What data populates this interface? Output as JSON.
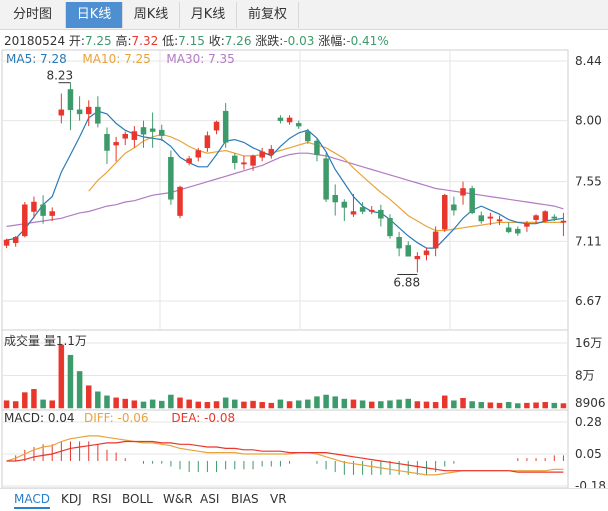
{
  "tabs": [
    {
      "label": "分时图",
      "active": false
    },
    {
      "label": "日K线",
      "active": true
    },
    {
      "label": "周K线",
      "active": false
    },
    {
      "label": "月K线",
      "active": false
    },
    {
      "label": "前复权",
      "active": false
    }
  ],
  "info": {
    "date": "20180524",
    "open_label": "开:",
    "open": "7.25",
    "high_label": "高:",
    "high": "7.32",
    "low_label": "低:",
    "low": "7.15",
    "close_label": "收:",
    "close": "7.26",
    "change_label": "涨跌:",
    "change": "-0.03",
    "pct_label": "涨幅:",
    "pct": "-0.41%"
  },
  "ma_legend": [
    {
      "label": "MA5: 7.28",
      "color": "#2a7ab8"
    },
    {
      "label": "MA10: 7.25",
      "color": "#e8a33c"
    },
    {
      "label": "MA30: 7.35",
      "color": "#b27bc4"
    }
  ],
  "colors": {
    "up": "#e8362c",
    "down": "#3d9a6a",
    "grid": "#e6e6e6",
    "axis": "#cfcfcf"
  },
  "bottom_tabs": [
    "MACD",
    "KDJ",
    "RSI",
    "BOLL",
    "W&R",
    "ASI",
    "BIAS",
    "VR"
  ],
  "chart_data": [
    {
      "type": "candlestick",
      "y_ticks": [
        "8.44",
        "8.00",
        "7.55",
        "7.11",
        "6.67"
      ],
      "ylim": [
        6.67,
        8.44
      ],
      "annotations": [
        {
          "text": "8.23"
        },
        {
          "text": "6.88"
        }
      ],
      "ohlc": [
        [
          7.08,
          7.13,
          7.06,
          7.12
        ],
        [
          7.1,
          7.15,
          7.07,
          7.14
        ],
        [
          7.15,
          7.4,
          7.14,
          7.38
        ],
        [
          7.33,
          7.44,
          7.28,
          7.4
        ],
        [
          7.38,
          7.45,
          7.24,
          7.3
        ],
        [
          7.3,
          7.36,
          7.26,
          7.33
        ],
        [
          8.04,
          8.2,
          7.98,
          8.08
        ],
        [
          8.23,
          8.28,
          7.93,
          8.08
        ],
        [
          8.08,
          8.18,
          8.0,
          8.05
        ],
        [
          8.05,
          8.15,
          7.96,
          8.1
        ],
        [
          8.1,
          8.18,
          7.95,
          7.98
        ],
        [
          7.9,
          7.95,
          7.68,
          7.78
        ],
        [
          7.82,
          7.88,
          7.7,
          7.84
        ],
        [
          7.87,
          7.92,
          7.82,
          7.9
        ],
        [
          7.86,
          7.96,
          7.8,
          7.92
        ],
        [
          7.95,
          8.0,
          7.8,
          7.9
        ],
        [
          7.94,
          8.06,
          7.8,
          7.92
        ],
        [
          7.93,
          7.97,
          7.85,
          7.89
        ],
        [
          7.73,
          7.78,
          7.38,
          7.42
        ],
        [
          7.3,
          7.52,
          7.28,
          7.51
        ],
        [
          7.69,
          7.74,
          7.67,
          7.72
        ],
        [
          7.73,
          7.8,
          7.7,
          7.78
        ],
        [
          7.8,
          7.92,
          7.77,
          7.89
        ],
        [
          7.93,
          8.0,
          7.9,
          7.99
        ],
        [
          8.07,
          8.13,
          7.8,
          7.84
        ],
        [
          7.74,
          7.76,
          7.64,
          7.69
        ],
        [
          7.68,
          7.74,
          7.64,
          7.69
        ],
        [
          7.67,
          7.75,
          7.63,
          7.74
        ],
        [
          7.73,
          7.8,
          7.7,
          7.77
        ],
        [
          7.75,
          7.82,
          7.72,
          7.79
        ],
        [
          8.02,
          8.04,
          7.98,
          8.0
        ],
        [
          7.99,
          8.04,
          7.97,
          8.02
        ],
        [
          7.98,
          8.0,
          7.94,
          7.96
        ],
        [
          7.92,
          7.94,
          7.83,
          7.85
        ],
        [
          7.85,
          7.87,
          7.7,
          7.75
        ],
        [
          7.72,
          7.76,
          7.4,
          7.42
        ],
        [
          7.45,
          7.53,
          7.3,
          7.4
        ],
        [
          7.4,
          7.42,
          7.26,
          7.36
        ],
        [
          7.31,
          7.46,
          7.29,
          7.33
        ],
        [
          7.36,
          7.4,
          7.31,
          7.33
        ],
        [
          7.33,
          7.37,
          7.31,
          7.34
        ],
        [
          7.34,
          7.38,
          7.22,
          7.28
        ],
        [
          7.28,
          7.31,
          7.13,
          7.15
        ],
        [
          7.14,
          7.18,
          7.0,
          7.06
        ],
        [
          7.08,
          7.11,
          7.0,
          7.0
        ],
        [
          6.98,
          7.03,
          6.88,
          7.0
        ],
        [
          7.01,
          7.06,
          6.97,
          7.04
        ],
        [
          7.06,
          7.22,
          7.0,
          7.18
        ],
        [
          7.2,
          7.46,
          7.18,
          7.45
        ],
        [
          7.38,
          7.44,
          7.3,
          7.34
        ],
        [
          7.45,
          7.55,
          7.38,
          7.5
        ],
        [
          7.5,
          7.52,
          7.31,
          7.32
        ],
        [
          7.3,
          7.33,
          7.24,
          7.26
        ],
        [
          7.28,
          7.32,
          7.23,
          7.29
        ],
        [
          7.26,
          7.3,
          7.23,
          7.27
        ],
        [
          7.21,
          7.25,
          7.17,
          7.18
        ],
        [
          7.2,
          7.22,
          7.15,
          7.17
        ],
        [
          7.22,
          7.26,
          7.18,
          7.24
        ],
        [
          7.27,
          7.31,
          7.24,
          7.3
        ],
        [
          7.26,
          7.34,
          7.25,
          7.33
        ],
        [
          7.29,
          7.31,
          7.26,
          7.28
        ],
        [
          7.25,
          7.32,
          7.15,
          7.26
        ]
      ],
      "ma5": [
        7.12,
        7.13,
        7.2,
        7.29,
        7.38,
        7.44,
        7.62,
        7.75,
        7.88,
        8.02,
        8.07,
        8.05,
        7.98,
        7.93,
        7.9,
        7.88,
        7.87,
        7.86,
        7.81,
        7.73,
        7.69,
        7.66,
        7.66,
        7.75,
        7.85,
        7.86,
        7.84,
        7.8,
        7.77,
        7.74,
        7.81,
        7.87,
        7.91,
        7.93,
        7.87,
        7.77,
        7.64,
        7.54,
        7.44,
        7.37,
        7.33,
        7.32,
        7.27,
        7.21,
        7.15,
        7.1,
        7.06,
        7.06,
        7.13,
        7.2,
        7.28,
        7.34,
        7.37,
        7.34,
        7.31,
        7.27,
        7.25,
        7.24,
        7.24,
        7.26,
        7.27,
        7.28
      ],
      "ma10": [
        null,
        null,
        null,
        null,
        null,
        null,
        null,
        null,
        null,
        7.48,
        7.56,
        7.62,
        7.69,
        7.76,
        7.8,
        7.85,
        7.88,
        7.9,
        7.88,
        7.85,
        7.81,
        7.78,
        7.76,
        7.77,
        7.78,
        7.76,
        7.74,
        7.74,
        7.75,
        7.76,
        7.78,
        7.8,
        7.82,
        7.84,
        7.82,
        7.8,
        7.76,
        7.72,
        7.65,
        7.59,
        7.53,
        7.47,
        7.42,
        7.36,
        7.3,
        7.26,
        7.22,
        7.19,
        7.19,
        7.2,
        7.21,
        7.22,
        7.23,
        7.24,
        7.25,
        7.25,
        7.25,
        7.25,
        7.25,
        7.25,
        7.25,
        7.25
      ],
      "ma30": [
        7.22,
        7.23,
        7.24,
        7.25,
        7.26,
        7.27,
        7.28,
        7.3,
        7.32,
        7.33,
        7.35,
        7.37,
        7.38,
        7.4,
        7.41,
        7.43,
        7.45,
        7.46,
        7.47,
        7.49,
        7.51,
        7.53,
        7.55,
        7.57,
        7.59,
        7.61,
        7.63,
        7.65,
        7.67,
        7.7,
        7.73,
        7.75,
        7.76,
        7.76,
        7.75,
        7.74,
        7.72,
        7.7,
        7.68,
        7.66,
        7.64,
        7.62,
        7.6,
        7.58,
        7.56,
        7.54,
        7.52,
        7.5,
        7.49,
        7.48,
        7.47,
        7.46,
        7.45,
        7.44,
        7.43,
        7.42,
        7.41,
        7.4,
        7.39,
        7.38,
        7.37,
        7.35
      ]
    },
    {
      "type": "bar",
      "title": "成交量 量1.1万",
      "y_ticks": [
        "16万",
        "8万",
        "8906"
      ],
      "ylim": [
        0,
        160000
      ],
      "values": [
        18000,
        16000,
        38000,
        46000,
        20000,
        18000,
        155000,
        130000,
        90000,
        55000,
        40000,
        30000,
        25000,
        22000,
        18000,
        15000,
        20000,
        17000,
        32000,
        25000,
        20000,
        15000,
        14000,
        16000,
        25000,
        20000,
        15000,
        17000,
        14000,
        12000,
        20000,
        16000,
        18000,
        20000,
        28000,
        32000,
        28000,
        22000,
        20000,
        18000,
        15000,
        16000,
        18000,
        20000,
        22000,
        16000,
        15000,
        14000,
        30000,
        18000,
        24000,
        16000,
        14000,
        13000,
        12000,
        14000,
        11000,
        12000,
        13000,
        14000,
        12000,
        11000
      ],
      "up": [
        true,
        true,
        true,
        true,
        false,
        true,
        true,
        false,
        false,
        true,
        false,
        false,
        true,
        true,
        true,
        false,
        false,
        false,
        false,
        true,
        true,
        true,
        true,
        true,
        false,
        false,
        true,
        true,
        true,
        true,
        false,
        true,
        false,
        false,
        false,
        false,
        false,
        false,
        true,
        false,
        true,
        false,
        false,
        false,
        false,
        true,
        true,
        true,
        true,
        false,
        true,
        false,
        false,
        true,
        true,
        false,
        false,
        true,
        true,
        true,
        false,
        true
      ]
    },
    {
      "type": "line",
      "title_parts": [
        {
          "label": "MACD: 0.04",
          "color": "#333333"
        },
        {
          "label": "DIFF: -0.06",
          "color": "#e8a33c"
        },
        {
          "label": "DEA: -0.08",
          "color": "#e8362c"
        }
      ],
      "y_ticks": [
        "0.28",
        "0.05",
        "-0.18"
      ],
      "ylim": [
        -0.18,
        0.28
      ],
      "diff": [
        0.0,
        0.02,
        0.05,
        0.08,
        0.1,
        0.11,
        0.14,
        0.16,
        0.17,
        0.18,
        0.18,
        0.17,
        0.16,
        0.15,
        0.14,
        0.13,
        0.13,
        0.12,
        0.11,
        0.09,
        0.08,
        0.07,
        0.06,
        0.06,
        0.06,
        0.06,
        0.05,
        0.05,
        0.05,
        0.05,
        0.05,
        0.05,
        0.06,
        0.06,
        0.05,
        0.03,
        0.01,
        -0.01,
        -0.02,
        -0.03,
        -0.04,
        -0.05,
        -0.06,
        -0.07,
        -0.08,
        -0.09,
        -0.1,
        -0.1,
        -0.09,
        -0.08,
        -0.07,
        -0.07,
        -0.07,
        -0.07,
        -0.07,
        -0.07,
        -0.07,
        -0.07,
        -0.07,
        -0.07,
        -0.06,
        -0.06
      ],
      "dea": [
        0.0,
        0.0,
        0.01,
        0.03,
        0.04,
        0.05,
        0.07,
        0.09,
        0.1,
        0.11,
        0.12,
        0.13,
        0.13,
        0.14,
        0.14,
        0.14,
        0.14,
        0.13,
        0.13,
        0.12,
        0.12,
        0.11,
        0.1,
        0.1,
        0.09,
        0.09,
        0.08,
        0.08,
        0.07,
        0.07,
        0.07,
        0.06,
        0.06,
        0.06,
        0.06,
        0.06,
        0.05,
        0.04,
        0.03,
        0.02,
        0.01,
        0.0,
        -0.01,
        -0.02,
        -0.03,
        -0.04,
        -0.05,
        -0.06,
        -0.07,
        -0.07,
        -0.07,
        -0.07,
        -0.07,
        -0.07,
        -0.07,
        -0.07,
        -0.08,
        -0.08,
        -0.08,
        -0.08,
        -0.08,
        -0.08
      ],
      "macd_histogram": [
        0.0,
        0.04,
        0.08,
        0.1,
        0.12,
        0.12,
        0.14,
        0.14,
        0.14,
        0.14,
        0.12,
        0.08,
        0.06,
        0.02,
        0.0,
        -0.02,
        -0.02,
        -0.02,
        -0.04,
        -0.06,
        -0.08,
        -0.08,
        -0.08,
        -0.08,
        -0.06,
        -0.06,
        -0.06,
        -0.06,
        -0.04,
        -0.04,
        -0.04,
        -0.02,
        0.0,
        0.0,
        -0.02,
        -0.06,
        -0.08,
        -0.1,
        -0.1,
        -0.1,
        -0.1,
        -0.1,
        -0.1,
        -0.1,
        -0.1,
        -0.1,
        -0.1,
        -0.08,
        -0.04,
        -0.02,
        0.0,
        0.0,
        0.0,
        0.0,
        0.0,
        0.0,
        0.02,
        0.02,
        0.02,
        0.02,
        0.04,
        0.04
      ]
    }
  ]
}
